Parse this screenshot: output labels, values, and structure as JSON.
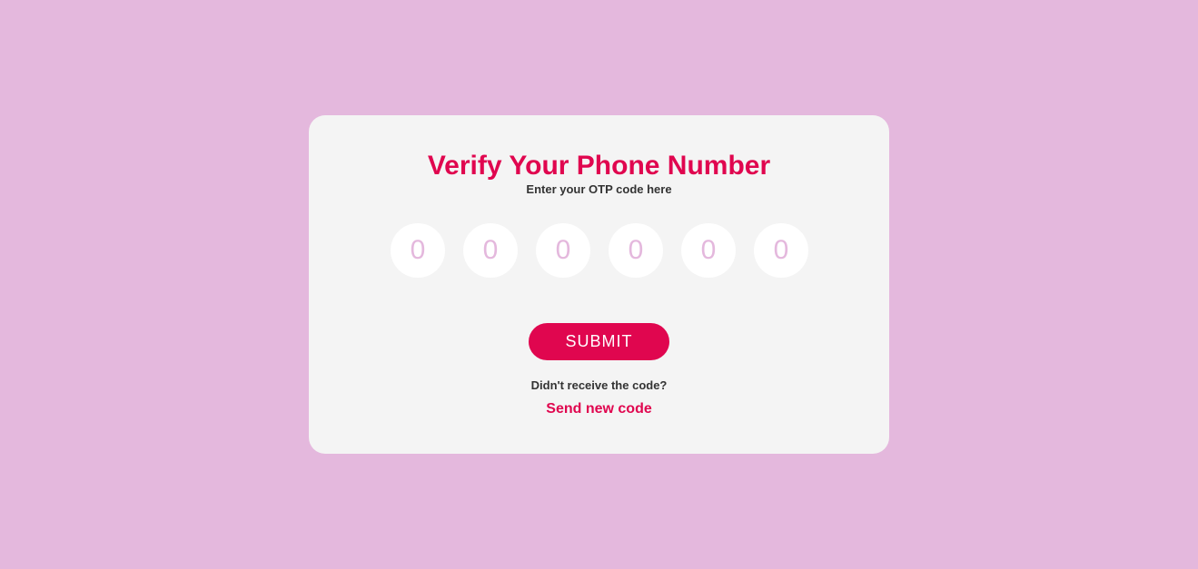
{
  "verify": {
    "title": "Verify Your Phone Number",
    "subtitle": "Enter your OTP code here",
    "otp": {
      "digits": [
        {
          "value": "",
          "placeholder": "0"
        },
        {
          "value": "",
          "placeholder": "0"
        },
        {
          "value": "",
          "placeholder": "0"
        },
        {
          "value": "",
          "placeholder": "0"
        },
        {
          "value": "",
          "placeholder": "0"
        },
        {
          "value": "",
          "placeholder": "0"
        }
      ]
    },
    "submit_label": "SUBMIT",
    "resend_prompt": "Didn't receive the code?",
    "resend_link": "Send new code"
  },
  "colors": {
    "background": "#e4b8dd",
    "card": "#f4f4f4",
    "accent": "#e0064f",
    "text": "#333333"
  }
}
